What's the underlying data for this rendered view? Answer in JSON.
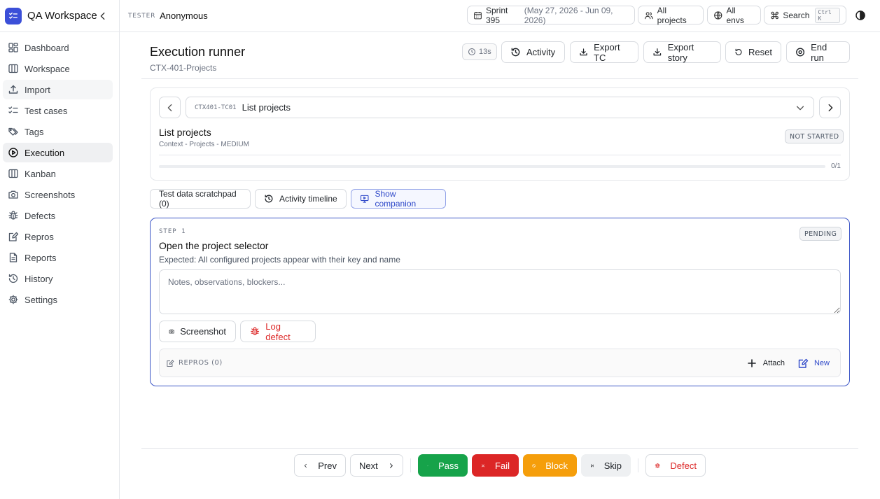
{
  "app": {
    "title": "QA Workspace"
  },
  "sidebar": {
    "items": [
      {
        "label": "Dashboard",
        "icon": "dashboard-icon"
      },
      {
        "label": "Workspace",
        "icon": "columns-icon"
      },
      {
        "label": "Import",
        "icon": "upload-icon"
      },
      {
        "label": "Test cases",
        "icon": "checklist-icon"
      },
      {
        "label": "Tags",
        "icon": "tags-icon"
      },
      {
        "label": "Execution",
        "icon": "play-circle-icon"
      },
      {
        "label": "Kanban",
        "icon": "kanban-icon"
      },
      {
        "label": "Screenshots",
        "icon": "camera-icon"
      },
      {
        "label": "Defects",
        "icon": "bug-icon"
      },
      {
        "label": "Repros",
        "icon": "edit-note-icon"
      },
      {
        "label": "Reports",
        "icon": "report-icon"
      },
      {
        "label": "History",
        "icon": "history-icon"
      },
      {
        "label": "Settings",
        "icon": "gear-icon"
      }
    ]
  },
  "topbar": {
    "tester_label": "TESTER",
    "tester_name": "Anonymous",
    "sprint": "Sprint 395",
    "sprint_dates": "(May 27, 2026 - Jun 09, 2026)",
    "projects": "All projects",
    "envs": "All envs",
    "search": "Search",
    "search_kbd": "Ctrl K"
  },
  "header": {
    "title": "Execution runner",
    "subtitle": "CTX-401-Projects",
    "timer": "13s",
    "activity": "Activity",
    "export_tc": "Export TC",
    "export_story": "Export story",
    "reset": "Reset",
    "end_run": "End run"
  },
  "testcase": {
    "code": "CTX401-TC01",
    "select_name": "List projects",
    "title": "List projects",
    "meta": "Context - Projects - MEDIUM",
    "status": "NOT STARTED",
    "progress_text": "0/1",
    "progress_fraction": 0
  },
  "toolbar": {
    "scratchpad": "Test data scratchpad (0)",
    "timeline": "Activity timeline",
    "companion": "Show companion"
  },
  "step": {
    "label": "STEP 1",
    "title": "Open the project selector",
    "expected": "Expected: All configured projects appear with their key and name",
    "notes_placeholder": "Notes, observations, blockers...",
    "status": "PENDING",
    "screenshot": "Screenshot",
    "log_defect": "Log defect",
    "repros_label": "REPROS (0)",
    "attach": "Attach",
    "new": "New"
  },
  "bottom": {
    "prev": "Prev",
    "next": "Next",
    "pass": "Pass",
    "fail": "Fail",
    "block": "Block",
    "skip": "Skip",
    "defect": "Defect"
  },
  "colors": {
    "accent": "#3b4fd8",
    "pass": "#16a34a",
    "fail": "#dc2626",
    "block": "#f59e0b"
  }
}
